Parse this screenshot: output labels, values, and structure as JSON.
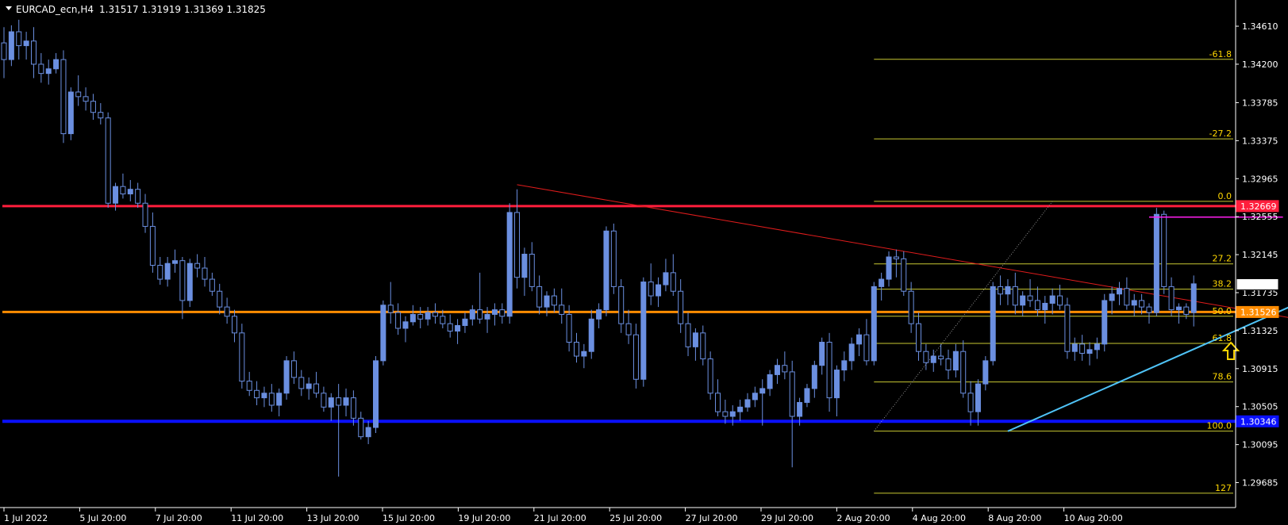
{
  "header": {
    "symbol_timeframe": "EURCAD_ecn,H4",
    "ohlc": "1.31517 1.31919 1.31369 1.31825"
  },
  "colors": {
    "background": "#000000",
    "grid_frame": "#ffffff",
    "bull_candle": "#6b8fe0",
    "bear_candle": "#6b8fe0",
    "resistance": "#ff1e3c",
    "pivot": "#ff8c00",
    "support": "#0a10ff",
    "trendline_down": "#e01c1c",
    "trendline_up": "#4fc3f7",
    "fib": "#c8c832",
    "fib_text": "#ffd700",
    "magenta_line": "#ff1ef0",
    "arrow": "#ffd700"
  },
  "chart_data": {
    "type": "candlestick",
    "title": "EURCAD_ecn,H4",
    "ohlc_readout": "1.31517 1.31919 1.31369 1.31825",
    "ylim": [
      1.2945,
      1.3485
    ],
    "y_ticks": [
      "1.34610",
      "1.34200",
      "1.33785",
      "1.33375",
      "1.32965",
      "1.32555",
      "1.32145",
      "1.31735",
      "1.31325",
      "1.30915",
      "1.30505",
      "1.30095",
      "1.29685"
    ],
    "x_ticks": [
      "1 Jul 2022",
      "5 Jul 20:00",
      "7 Jul 20:00",
      "11 Jul 20:00",
      "13 Jul 20:00",
      "15 Jul 20:00",
      "19 Jul 20:00",
      "21 Jul 20:00",
      "25 Jul 20:00",
      "27 Jul 20:00",
      "29 Jul 20:00",
      "2 Aug 20:00",
      "4 Aug 20:00",
      "8 Aug 20:00",
      "10 Aug 20:00"
    ],
    "price_tags": [
      {
        "label": "1.32669",
        "value": 1.32669,
        "color": "#ff1e3c"
      },
      {
        "label": "1.31825",
        "value": 1.31825,
        "color": "#ffffff"
      },
      {
        "label": "1.31526",
        "value": 1.31526,
        "color": "#ff8c00"
      },
      {
        "label": "1.30346",
        "value": 1.30346,
        "color": "#0a10ff"
      }
    ],
    "horizontal_levels": [
      {
        "name": "resistance",
        "value": 1.32669
      },
      {
        "name": "pivot",
        "value": 1.31526
      },
      {
        "name": "support",
        "value": 1.30346
      }
    ],
    "fibonacci": {
      "high": 1.3272,
      "low": 1.3024,
      "levels": [
        {
          "label": "-61.8",
          "ratio": -0.618
        },
        {
          "label": "-27.2",
          "ratio": -0.272
        },
        {
          "label": "0.0",
          "ratio": 0.0
        },
        {
          "label": "27.2",
          "ratio": 0.272
        },
        {
          "label": "38.2",
          "ratio": 0.382
        },
        {
          "label": "50.0",
          "ratio": 0.5
        },
        {
          "label": "61.8",
          "ratio": 0.618
        },
        {
          "label": "78.6",
          "ratio": 0.786
        },
        {
          "label": "100.0",
          "ratio": 1.0
        },
        {
          "label": "127",
          "ratio": 1.27
        }
      ]
    },
    "trendlines": [
      {
        "name": "downtrend",
        "from": [
          69,
          1.329
        ],
        "to": [
          187,
          1.3127
        ]
      },
      {
        "name": "uptrend",
        "from": [
          135,
          1.3024
        ],
        "to": [
          187,
          1.3208
        ]
      }
    ],
    "magenta_level": {
      "value": 1.3255,
      "from": 154,
      "to": 172
    },
    "arrow_bar": 165,
    "candles": [
      [
        1.3443,
        1.346,
        1.3405,
        1.3425
      ],
      [
        1.3425,
        1.3462,
        1.3418,
        1.3455
      ],
      [
        1.3455,
        1.3468,
        1.3425,
        1.344
      ],
      [
        1.344,
        1.3455,
        1.3425,
        1.3445
      ],
      [
        1.3445,
        1.346,
        1.3405,
        1.342
      ],
      [
        1.342,
        1.3432,
        1.34,
        1.341
      ],
      [
        1.341,
        1.3425,
        1.3398,
        1.3415
      ],
      [
        1.3415,
        1.3432,
        1.341,
        1.3425
      ],
      [
        1.3425,
        1.3435,
        1.3335,
        1.3345
      ],
      [
        1.3345,
        1.3395,
        1.3338,
        1.339
      ],
      [
        1.339,
        1.3408,
        1.3375,
        1.3385
      ],
      [
        1.3385,
        1.3395,
        1.337,
        1.338
      ],
      [
        1.338,
        1.3388,
        1.336,
        1.3368
      ],
      [
        1.3368,
        1.3378,
        1.3355,
        1.3362
      ],
      [
        1.3362,
        1.3368,
        1.3265,
        1.327
      ],
      [
        1.327,
        1.3292,
        1.3262,
        1.3288
      ],
      [
        1.3288,
        1.3302,
        1.3275,
        1.328
      ],
      [
        1.328,
        1.3295,
        1.3272,
        1.3285
      ],
      [
        1.3285,
        1.3292,
        1.3265,
        1.327
      ],
      [
        1.327,
        1.328,
        1.3238,
        1.3245
      ],
      [
        1.3245,
        1.326,
        1.3195,
        1.3203
      ],
      [
        1.3203,
        1.3212,
        1.3182,
        1.3188
      ],
      [
        1.3188,
        1.3212,
        1.318,
        1.3205
      ],
      [
        1.3205,
        1.322,
        1.3195,
        1.3208
      ],
      [
        1.3208,
        1.3212,
        1.3145,
        1.3165
      ],
      [
        1.3165,
        1.321,
        1.3158,
        1.3205
      ],
      [
        1.3205,
        1.3215,
        1.319,
        1.32
      ],
      [
        1.32,
        1.3212,
        1.318,
        1.3188
      ],
      [
        1.3188,
        1.3195,
        1.317,
        1.3175
      ],
      [
        1.3175,
        1.3183,
        1.315,
        1.3158
      ],
      [
        1.3158,
        1.3168,
        1.314,
        1.3148
      ],
      [
        1.3148,
        1.3155,
        1.312,
        1.313
      ],
      [
        1.313,
        1.314,
        1.307,
        1.3078
      ],
      [
        1.3078,
        1.3088,
        1.3062,
        1.3068
      ],
      [
        1.3068,
        1.3078,
        1.3052,
        1.306
      ],
      [
        1.306,
        1.3072,
        1.305,
        1.3065
      ],
      [
        1.3065,
        1.3075,
        1.3045,
        1.3052
      ],
      [
        1.3052,
        1.307,
        1.304,
        1.3065
      ],
      [
        1.3065,
        1.3105,
        1.3058,
        1.31
      ],
      [
        1.31,
        1.311,
        1.3075,
        1.3082
      ],
      [
        1.3082,
        1.309,
        1.3062,
        1.307
      ],
      [
        1.307,
        1.3082,
        1.3058,
        1.3075
      ],
      [
        1.3075,
        1.3088,
        1.306,
        1.3065
      ],
      [
        1.3065,
        1.3072,
        1.3045,
        1.305
      ],
      [
        1.305,
        1.3065,
        1.3035,
        1.306
      ],
      [
        1.306,
        1.3075,
        1.2975,
        1.3052
      ],
      [
        1.3052,
        1.307,
        1.304,
        1.306
      ],
      [
        1.306,
        1.3068,
        1.303,
        1.3038
      ],
      [
        1.3038,
        1.3045,
        1.3015,
        1.3018
      ],
      [
        1.3018,
        1.3035,
        1.301,
        1.3028
      ],
      [
        1.3028,
        1.3105,
        1.3022,
        1.31
      ],
      [
        1.31,
        1.3165,
        1.3095,
        1.316
      ],
      [
        1.316,
        1.3185,
        1.314,
        1.3152
      ],
      [
        1.3152,
        1.3162,
        1.3128,
        1.3135
      ],
      [
        1.3135,
        1.3148,
        1.312,
        1.3142
      ],
      [
        1.3142,
        1.316,
        1.3138,
        1.315
      ],
      [
        1.315,
        1.3158,
        1.3135,
        1.3145
      ],
      [
        1.3145,
        1.3158,
        1.3138,
        1.3152
      ],
      [
        1.3152,
        1.3162,
        1.314,
        1.3148
      ],
      [
        1.3148,
        1.3155,
        1.3135,
        1.314
      ],
      [
        1.314,
        1.315,
        1.3125,
        1.3132
      ],
      [
        1.3132,
        1.3145,
        1.3118,
        1.3138
      ],
      [
        1.3138,
        1.3152,
        1.313,
        1.3145
      ],
      [
        1.3145,
        1.316,
        1.3138,
        1.3155
      ],
      [
        1.3155,
        1.3195,
        1.314,
        1.3145
      ],
      [
        1.3145,
        1.3158,
        1.313,
        1.315
      ],
      [
        1.315,
        1.3162,
        1.3138,
        1.3155
      ],
      [
        1.3155,
        1.3162,
        1.314,
        1.3148
      ],
      [
        1.3148,
        1.327,
        1.314,
        1.326
      ],
      [
        1.326,
        1.3285,
        1.3178,
        1.319
      ],
      [
        1.319,
        1.3222,
        1.317,
        1.3215
      ],
      [
        1.3215,
        1.3228,
        1.3175,
        1.318
      ],
      [
        1.318,
        1.3192,
        1.315,
        1.3158
      ],
      [
        1.3158,
        1.3175,
        1.3148,
        1.317
      ],
      [
        1.317,
        1.3178,
        1.3152,
        1.316
      ],
      [
        1.316,
        1.3178,
        1.314,
        1.315
      ],
      [
        1.315,
        1.316,
        1.311,
        1.312
      ],
      [
        1.312,
        1.313,
        1.3098,
        1.3105
      ],
      [
        1.3105,
        1.3118,
        1.3092,
        1.311
      ],
      [
        1.311,
        1.3155,
        1.3102,
        1.3145
      ],
      [
        1.3145,
        1.3162,
        1.3135,
        1.3155
      ],
      [
        1.3155,
        1.3245,
        1.3148,
        1.324
      ],
      [
        1.324,
        1.3248,
        1.3172,
        1.318
      ],
      [
        1.318,
        1.3188,
        1.313,
        1.314
      ],
      [
        1.314,
        1.3155,
        1.3118,
        1.3128
      ],
      [
        1.3128,
        1.314,
        1.307,
        1.308
      ],
      [
        1.308,
        1.319,
        1.3072,
        1.3185
      ],
      [
        1.3185,
        1.3205,
        1.316,
        1.317
      ],
      [
        1.317,
        1.319,
        1.3158,
        1.3182
      ],
      [
        1.3182,
        1.321,
        1.3175,
        1.3195
      ],
      [
        1.3195,
        1.3215,
        1.317,
        1.3175
      ],
      [
        1.3175,
        1.3188,
        1.313,
        1.314
      ],
      [
        1.314,
        1.3152,
        1.3105,
        1.3115
      ],
      [
        1.3115,
        1.3135,
        1.31,
        1.313
      ],
      [
        1.313,
        1.3138,
        1.3095,
        1.3102
      ],
      [
        1.3102,
        1.311,
        1.3058,
        1.3065
      ],
      [
        1.3065,
        1.308,
        1.304,
        1.3045
      ],
      [
        1.3045,
        1.3058,
        1.3032,
        1.304
      ],
      [
        1.304,
        1.3052,
        1.303,
        1.3045
      ],
      [
        1.3045,
        1.3058,
        1.3035,
        1.305
      ],
      [
        1.305,
        1.3065,
        1.3045,
        1.3058
      ],
      [
        1.3058,
        1.3072,
        1.305,
        1.3065
      ],
      [
        1.3065,
        1.308,
        1.303,
        1.307
      ],
      [
        1.307,
        1.309,
        1.3062,
        1.3085
      ],
      [
        1.3085,
        1.3102,
        1.3075,
        1.3095
      ],
      [
        1.3095,
        1.311,
        1.308,
        1.3088
      ],
      [
        1.3088,
        1.31,
        1.2985,
        1.304
      ],
      [
        1.304,
        1.306,
        1.303,
        1.3055
      ],
      [
        1.3055,
        1.3075,
        1.305,
        1.307
      ],
      [
        1.307,
        1.31,
        1.306,
        1.3095
      ],
      [
        1.3095,
        1.3125,
        1.3085,
        1.312
      ],
      [
        1.312,
        1.313,
        1.3045,
        1.306
      ],
      [
        1.306,
        1.3095,
        1.304,
        1.309
      ],
      [
        1.309,
        1.311,
        1.3078,
        1.31
      ],
      [
        1.31,
        1.3125,
        1.309,
        1.3118
      ],
      [
        1.3118,
        1.3135,
        1.3105,
        1.3128
      ],
      [
        1.3128,
        1.3145,
        1.3095,
        1.31
      ],
      [
        1.31,
        1.3185,
        1.3095,
        1.318
      ],
      [
        1.318,
        1.3195,
        1.3165,
        1.3188
      ],
      [
        1.3188,
        1.3218,
        1.318,
        1.3212
      ],
      [
        1.3212,
        1.322,
        1.319,
        1.321
      ],
      [
        1.321,
        1.3218,
        1.317,
        1.3175
      ],
      [
        1.3175,
        1.3185,
        1.313,
        1.314
      ],
      [
        1.314,
        1.3152,
        1.31,
        1.311
      ],
      [
        1.311,
        1.3118,
        1.309,
        1.3098
      ],
      [
        1.3098,
        1.3112,
        1.3088,
        1.3105
      ],
      [
        1.3105,
        1.3118,
        1.3095,
        1.3102
      ],
      [
        1.3102,
        1.3112,
        1.308,
        1.309
      ],
      [
        1.309,
        1.3118,
        1.3082,
        1.311
      ],
      [
        1.311,
        1.3122,
        1.306,
        1.3065
      ],
      [
        1.3065,
        1.3078,
        1.303,
        1.3045
      ],
      [
        1.3045,
        1.308,
        1.303,
        1.3075
      ],
      [
        1.3075,
        1.3105,
        1.3068,
        1.31
      ],
      [
        1.31,
        1.3185,
        1.3095,
        1.318
      ],
      [
        1.318,
        1.3192,
        1.316,
        1.3172
      ],
      [
        1.3172,
        1.3188,
        1.316,
        1.318
      ],
      [
        1.318,
        1.3195,
        1.315,
        1.316
      ],
      [
        1.316,
        1.3175,
        1.3148,
        1.317
      ],
      [
        1.317,
        1.3188,
        1.3158,
        1.3165
      ],
      [
        1.3165,
        1.318,
        1.3148,
        1.3155
      ],
      [
        1.3155,
        1.317,
        1.314,
        1.3162
      ],
      [
        1.3162,
        1.3178,
        1.315,
        1.317
      ],
      [
        1.317,
        1.3182,
        1.3155,
        1.316
      ],
      [
        1.316,
        1.3168,
        1.3102,
        1.311
      ],
      [
        1.311,
        1.3125,
        1.31,
        1.3118
      ],
      [
        1.3118,
        1.3128,
        1.31,
        1.3108
      ],
      [
        1.3108,
        1.312,
        1.3095,
        1.3112
      ],
      [
        1.3112,
        1.3125,
        1.3102,
        1.3118
      ],
      [
        1.3118,
        1.3172,
        1.311,
        1.3165
      ],
      [
        1.3165,
        1.318,
        1.315,
        1.3172
      ],
      [
        1.3172,
        1.3185,
        1.316,
        1.3178
      ],
      [
        1.3178,
        1.319,
        1.3155,
        1.316
      ],
      [
        1.316,
        1.3172,
        1.3148,
        1.3165
      ],
      [
        1.3165,
        1.3172,
        1.315,
        1.3158
      ],
      [
        1.3158,
        1.3162,
        1.314,
        1.3152
      ],
      [
        1.3152,
        1.3265,
        1.3148,
        1.3258
      ],
      [
        1.3258,
        1.3262,
        1.3172,
        1.318
      ],
      [
        1.318,
        1.319,
        1.3148,
        1.3155
      ],
      [
        1.3155,
        1.3162,
        1.314,
        1.3158
      ],
      [
        1.3158,
        1.3162,
        1.3145,
        1.315
      ],
      [
        1.3152,
        1.3192,
        1.3137,
        1.3183
      ]
    ]
  }
}
